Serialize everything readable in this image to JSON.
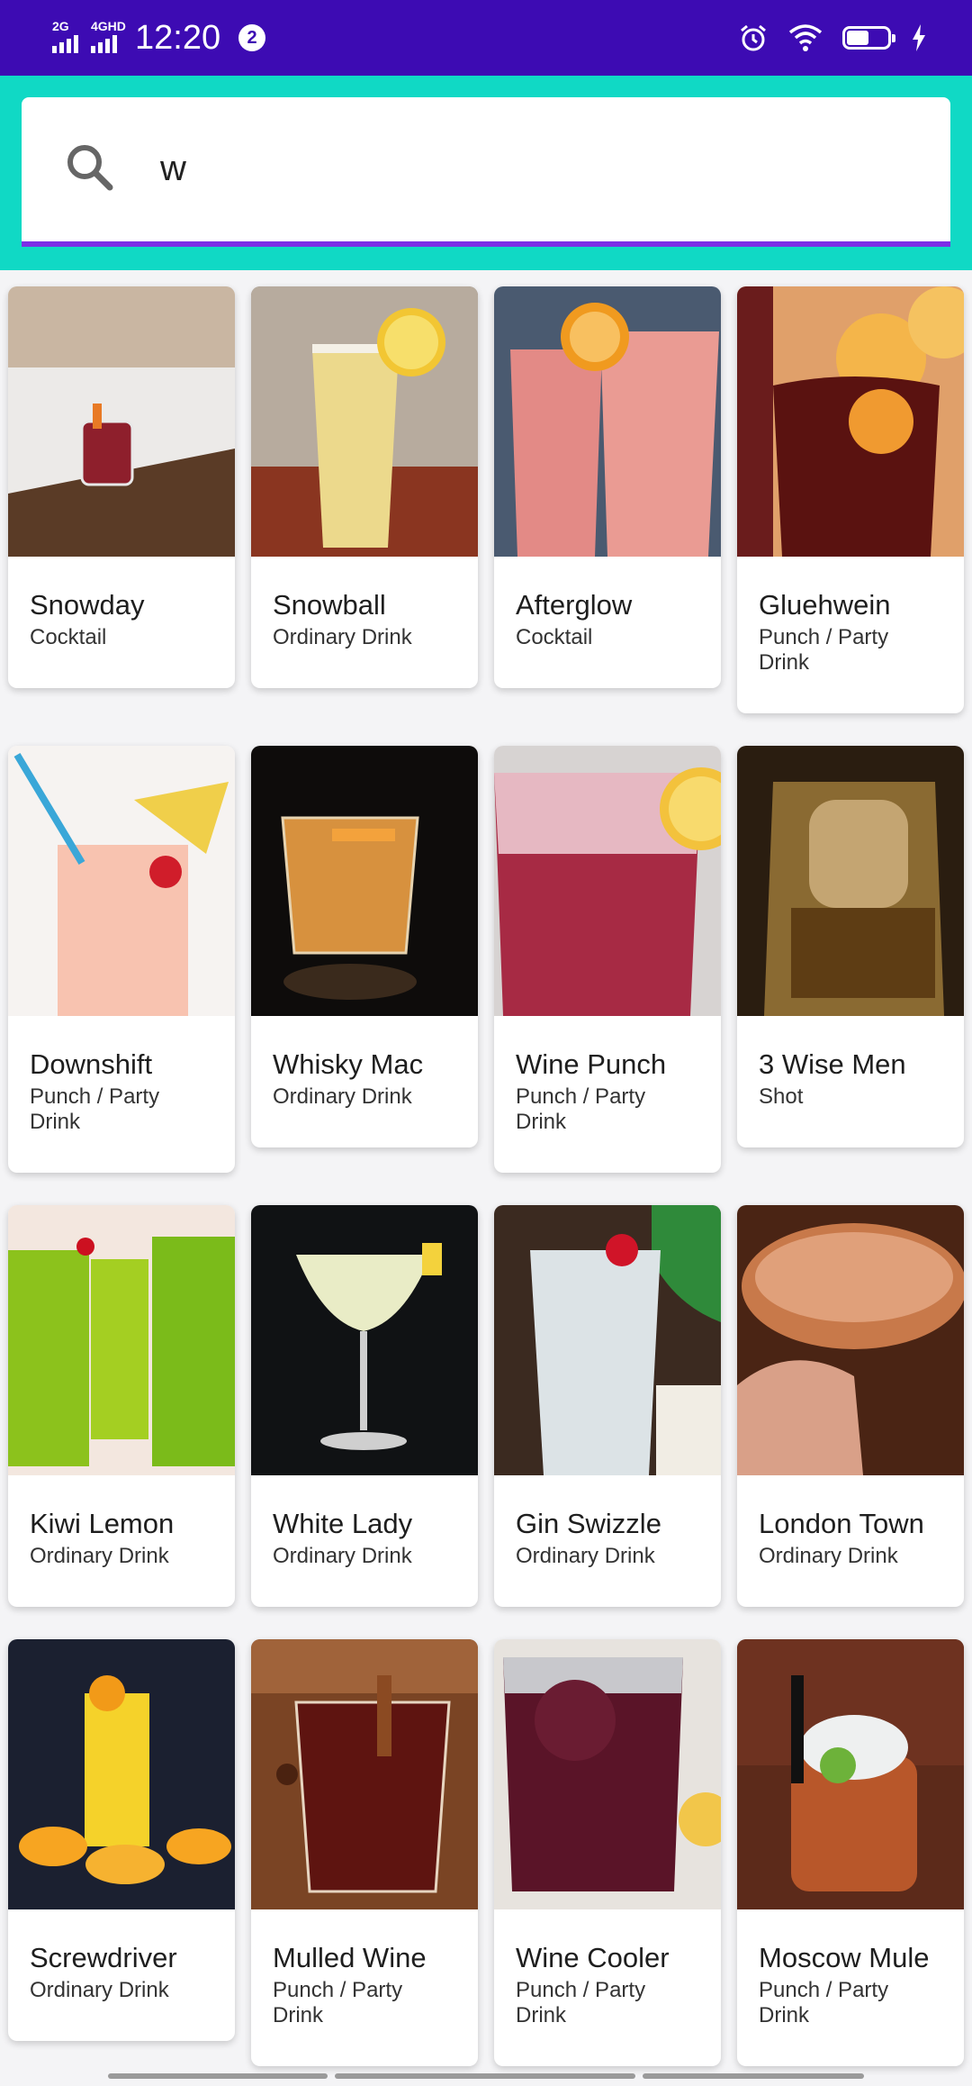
{
  "status_bar": {
    "net1": "2G",
    "net2": "4GHD",
    "time": "12:20",
    "notification_count": "2"
  },
  "search": {
    "value": "w",
    "accent_color": "#7c2ee6",
    "header_color": "#10d9c5"
  },
  "drinks": [
    {
      "name": "Snowday",
      "category": "Cocktail"
    },
    {
      "name": "Snowball",
      "category": "Ordinary Drink"
    },
    {
      "name": "Afterglow",
      "category": "Cocktail"
    },
    {
      "name": "Gluehwein",
      "category": "Punch / Party Drink"
    },
    {
      "name": "Downshift",
      "category": "Punch / Party Drink"
    },
    {
      "name": "Whisky Mac",
      "category": "Ordinary Drink"
    },
    {
      "name": "Wine Punch",
      "category": "Punch / Party Drink"
    },
    {
      "name": "3 Wise Men",
      "category": "Shot"
    },
    {
      "name": "Kiwi Lemon",
      "category": "Ordinary Drink"
    },
    {
      "name": "White Lady",
      "category": "Ordinary Drink"
    },
    {
      "name": "Gin Swizzle",
      "category": "Ordinary Drink"
    },
    {
      "name": "London Town",
      "category": "Ordinary Drink"
    },
    {
      "name": "Screwdriver",
      "category": "Ordinary Drink"
    },
    {
      "name": "Mulled Wine",
      "category": "Punch / Party Drink"
    },
    {
      "name": "Wine Cooler",
      "category": "Punch / Party Drink"
    },
    {
      "name": "Moscow Mule",
      "category": "Punch / Party Drink"
    }
  ]
}
